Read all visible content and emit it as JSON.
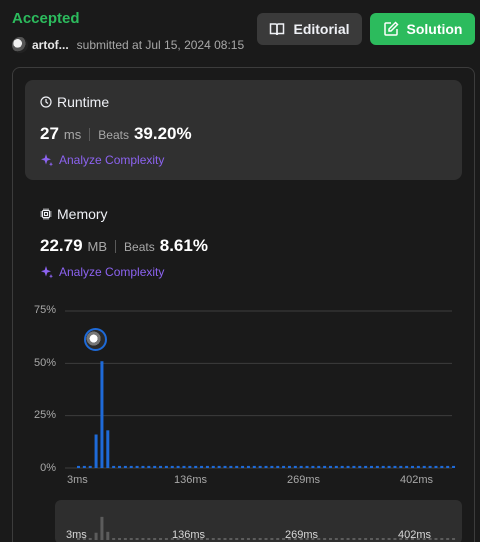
{
  "header": {
    "status": "Accepted",
    "username": "artof...",
    "submitted": "submitted at Jul 15, 2024 08:15",
    "editorial_label": "Editorial",
    "solution_label": "Solution"
  },
  "runtime": {
    "title": "Runtime",
    "value": "27",
    "unit": "ms",
    "beats_label": "Beats",
    "beats": "39.20%",
    "analyze": "Analyze Complexity"
  },
  "memory": {
    "title": "Memory",
    "value": "22.79",
    "unit": "MB",
    "beats_label": "Beats",
    "beats": "8.61%",
    "analyze": "Analyze Complexity"
  },
  "colors": {
    "accent_green": "#2cbb5d",
    "bar_blue": "#1e6ad8",
    "analyze_purple": "#8c63f0"
  },
  "chart_data": {
    "type": "bar",
    "ytick_labels": [
      "75%",
      "50%",
      "25%",
      "0%"
    ],
    "xtick_labels": [
      "3ms",
      "136ms",
      "269ms",
      "402ms"
    ],
    "ylim": [
      0,
      75
    ],
    "grid": true,
    "series": [
      {
        "values": [
          1,
          1,
          1,
          16,
          51,
          18,
          1,
          1,
          1,
          1,
          1,
          1,
          1,
          1,
          1,
          1,
          1,
          1,
          1,
          1,
          1,
          1,
          1,
          1,
          1,
          1,
          1,
          1,
          1,
          1,
          1,
          1,
          1,
          1,
          1,
          1,
          1,
          1,
          1,
          1,
          1,
          1,
          1,
          1,
          1,
          1,
          1,
          1,
          1,
          1,
          1,
          1,
          1,
          1,
          1,
          1,
          1,
          1,
          1,
          1,
          1,
          1,
          1,
          1,
          1
        ]
      }
    ],
    "highlight_index": 4,
    "navigator_ticks": [
      "3ms",
      "136ms",
      "269ms",
      "402ms"
    ]
  }
}
